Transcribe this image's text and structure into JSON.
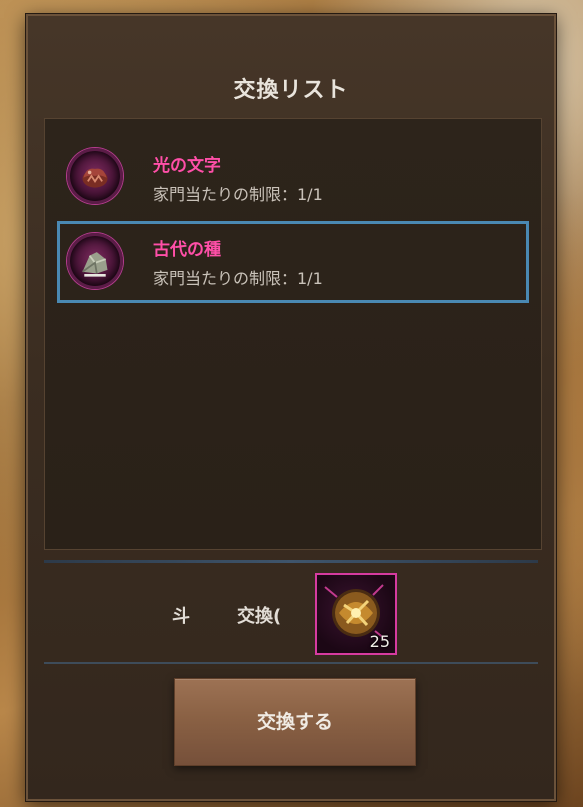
{
  "dialog": {
    "title": "交換リスト"
  },
  "exchange_list": [
    {
      "name": "光の文字",
      "limit_text": "家門当たりの制限：1/1",
      "selected": false,
      "icon": "red-item-icon"
    },
    {
      "name": "古代の種",
      "limit_text": "家門当たりの制限：1/1",
      "selected": true,
      "icon": "seed-item-icon"
    }
  ],
  "materials": {
    "label_partial": "斗",
    "exchange_label_partial": "交換("
  },
  "reward": {
    "count": "25",
    "icon": "golden-orb-icon"
  },
  "actions": {
    "exchange_button": "交換する"
  },
  "colors": {
    "item_name": "#ff4fa8",
    "selection_border": "#4a89b3",
    "reward_border": "#d63ba0"
  }
}
